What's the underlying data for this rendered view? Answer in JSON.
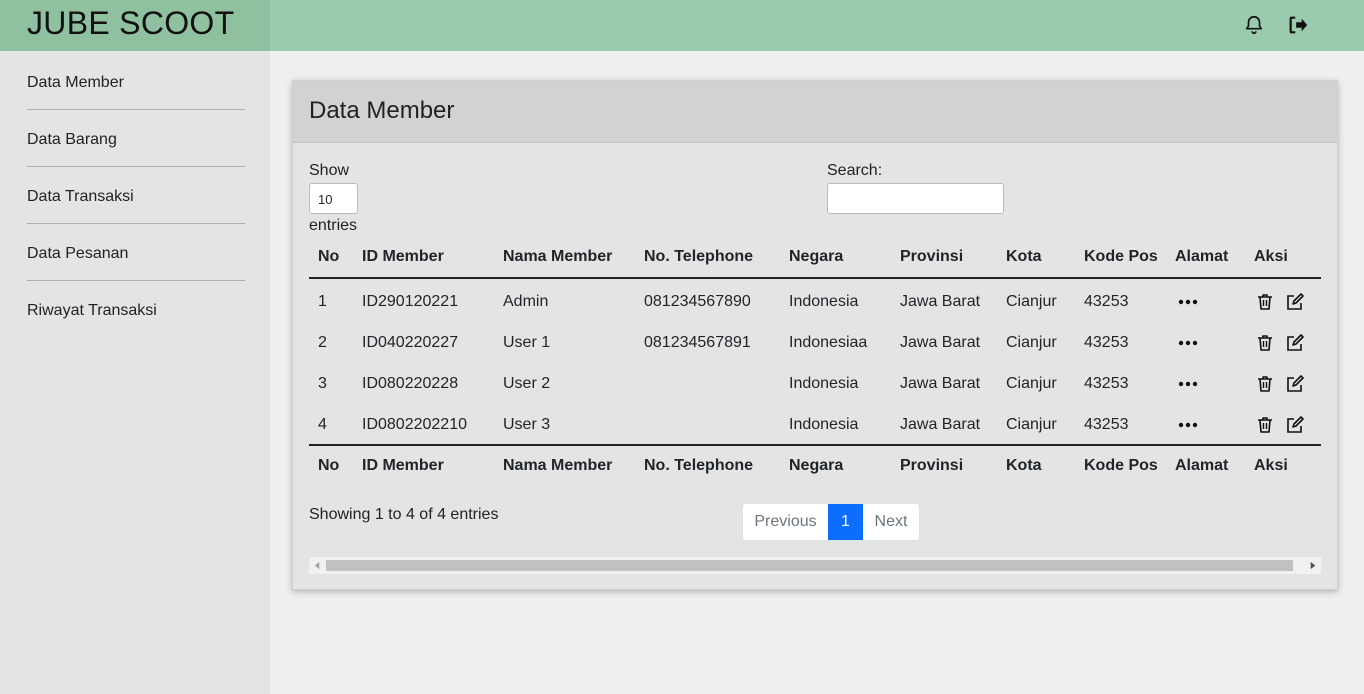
{
  "app": {
    "brand": "JUBE SCOOT"
  },
  "topbar": {
    "icons": [
      "bell-icon",
      "logout-icon"
    ]
  },
  "sidebar": {
    "items": [
      {
        "label": "Data Member"
      },
      {
        "label": "Data Barang"
      },
      {
        "label": "Data Transaksi"
      },
      {
        "label": "Data Pesanan"
      },
      {
        "label": "Riwayat Transaksi"
      }
    ]
  },
  "card": {
    "title": "Data Member"
  },
  "table_controls": {
    "show_label": "Show",
    "length_value": "10",
    "entries_label": "entries",
    "search_label": "Search:",
    "search_value": ""
  },
  "table": {
    "columns": [
      "No",
      "ID Member",
      "Nama Member",
      "No. Telephone",
      "Negara",
      "Provinsi",
      "Kota",
      "Kode Pos",
      "Alamat",
      "Aksi"
    ],
    "rows": [
      {
        "no": "1",
        "id": "ID290120221",
        "nama": "Admin",
        "telp": "081234567890",
        "negara": "Indonesia",
        "provinsi": "Jawa Barat",
        "kota": "Cianjur",
        "kodepos": "43253"
      },
      {
        "no": "2",
        "id": "ID040220227",
        "nama": "User 1",
        "telp": "081234567891",
        "negara": "Indonesiaa",
        "provinsi": "Jawa Barat",
        "kota": "Cianjur",
        "kodepos": "43253"
      },
      {
        "no": "3",
        "id": "ID080220228",
        "nama": "User 2",
        "telp": "",
        "negara": "Indonesia",
        "provinsi": "Jawa Barat",
        "kota": "Cianjur",
        "kodepos": "43253"
      },
      {
        "no": "4",
        "id": "ID0802202210",
        "nama": "User 3",
        "telp": "",
        "negara": "Indonesia",
        "provinsi": "Jawa Barat",
        "kota": "Cianjur",
        "kodepos": "43253"
      }
    ],
    "row_icons": {
      "alamat": "more-dots-icon",
      "delete": "trash-icon",
      "edit": "edit-icon"
    }
  },
  "info": "Showing 1 to 4 of 4 entries",
  "pagination": {
    "previous": "Previous",
    "current": "1",
    "next": "Next"
  },
  "colors": {
    "topbar": "#9bcbad",
    "brand_bg": "#8fc1a1",
    "sidebar": "#e4e4e4",
    "content_bg": "#efefef",
    "card_header": "#d2d2d2",
    "page_active": "#0d6efd"
  }
}
